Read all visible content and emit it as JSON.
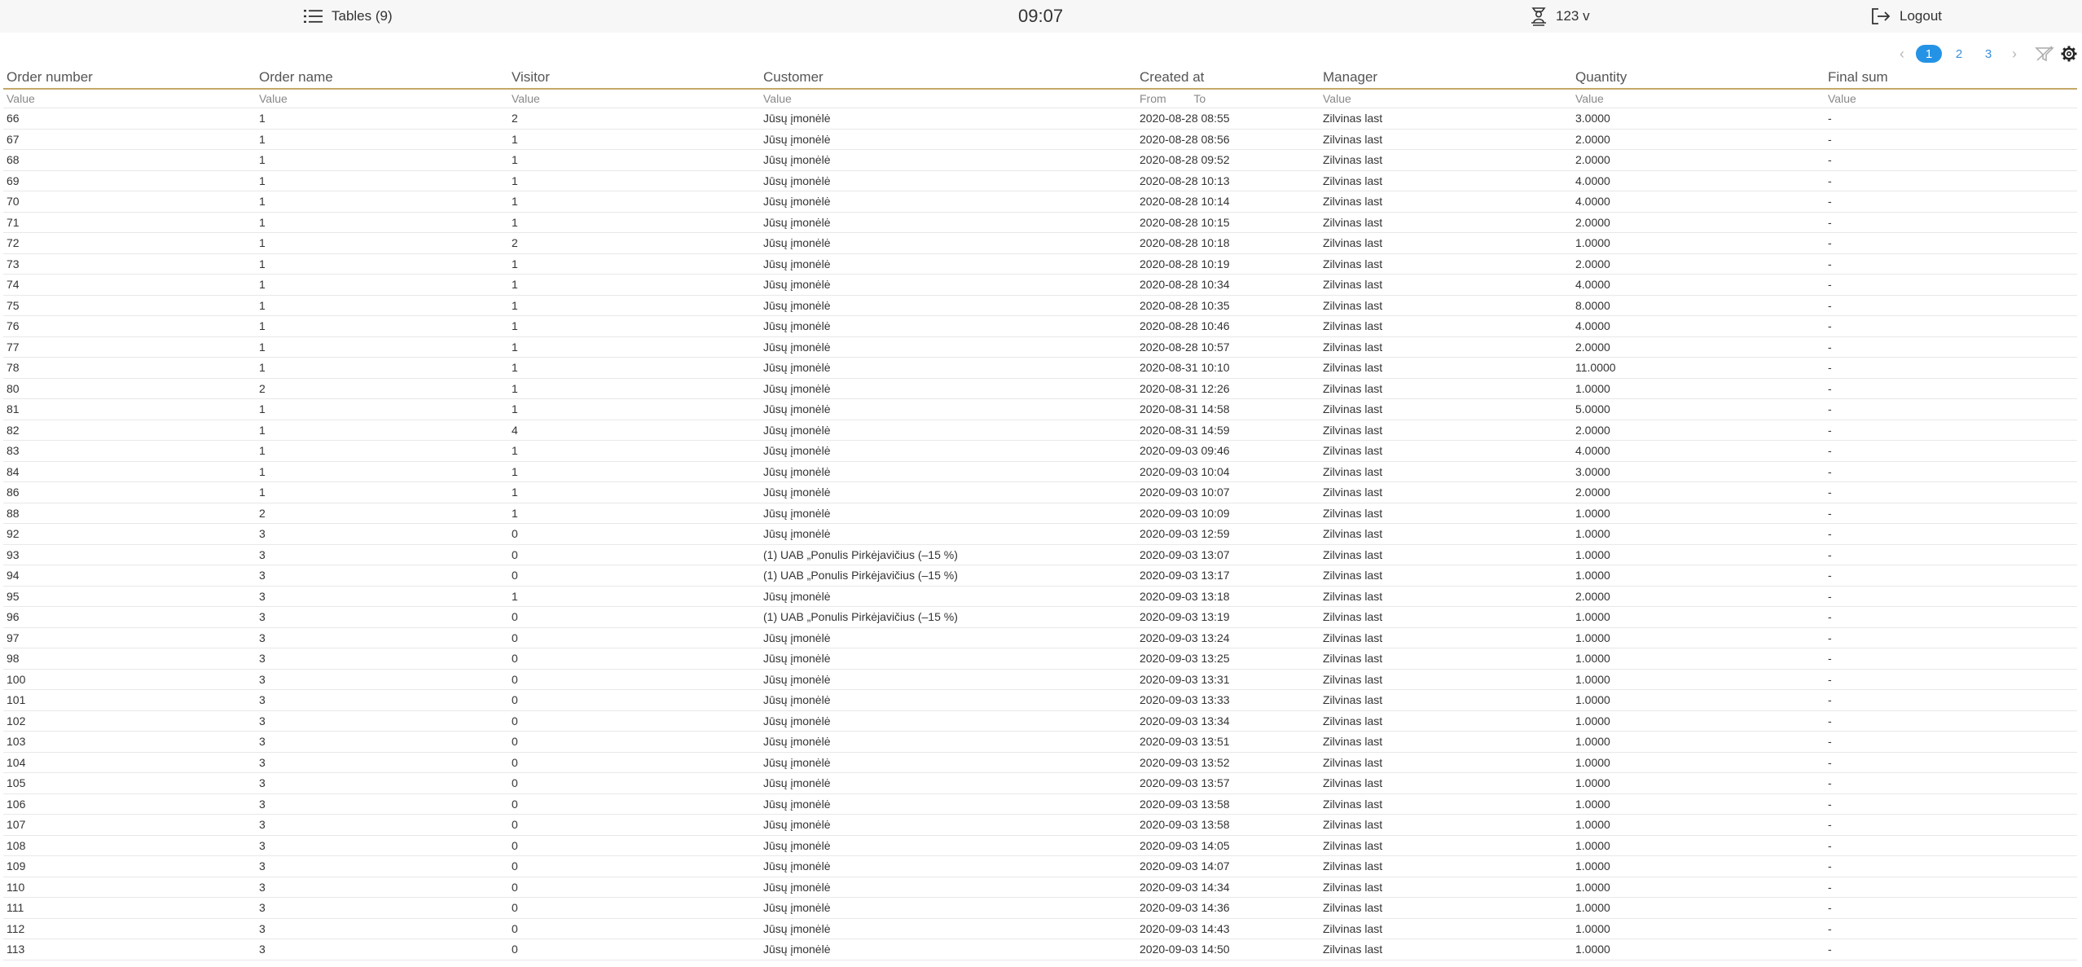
{
  "topbar": {
    "tables_label": "Tables (9)",
    "clock": "09:07",
    "user_label": "123 v",
    "logout_label": "Logout"
  },
  "pager": {
    "prev": "‹",
    "pages": [
      "1",
      "2",
      "3"
    ],
    "active": "1",
    "next": "›"
  },
  "columns": [
    "Order number",
    "Order name",
    "Visitor",
    "Customer",
    "Created at",
    "Manager",
    "Quantity",
    "Final sum"
  ],
  "filters": {
    "value_placeholder": "Value",
    "from_label": "From",
    "to_label": "To"
  },
  "rows": [
    [
      "66",
      "1",
      "2",
      "Jūsų įmonėlė",
      "2020-08-28 08:55",
      "Zilvinas last",
      "3.0000",
      "-"
    ],
    [
      "67",
      "1",
      "1",
      "Jūsų įmonėlė",
      "2020-08-28 08:56",
      "Zilvinas last",
      "2.0000",
      "-"
    ],
    [
      "68",
      "1",
      "1",
      "Jūsų įmonėlė",
      "2020-08-28 09:52",
      "Zilvinas last",
      "2.0000",
      "-"
    ],
    [
      "69",
      "1",
      "1",
      "Jūsų įmonėlė",
      "2020-08-28 10:13",
      "Zilvinas last",
      "4.0000",
      "-"
    ],
    [
      "70",
      "1",
      "1",
      "Jūsų įmonėlė",
      "2020-08-28 10:14",
      "Zilvinas last",
      "4.0000",
      "-"
    ],
    [
      "71",
      "1",
      "1",
      "Jūsų įmonėlė",
      "2020-08-28 10:15",
      "Zilvinas last",
      "2.0000",
      "-"
    ],
    [
      "72",
      "1",
      "2",
      "Jūsų įmonėlė",
      "2020-08-28 10:18",
      "Zilvinas last",
      "1.0000",
      "-"
    ],
    [
      "73",
      "1",
      "1",
      "Jūsų įmonėlė",
      "2020-08-28 10:19",
      "Zilvinas last",
      "2.0000",
      "-"
    ],
    [
      "74",
      "1",
      "1",
      "Jūsų įmonėlė",
      "2020-08-28 10:34",
      "Zilvinas last",
      "4.0000",
      "-"
    ],
    [
      "75",
      "1",
      "1",
      "Jūsų įmonėlė",
      "2020-08-28 10:35",
      "Zilvinas last",
      "8.0000",
      "-"
    ],
    [
      "76",
      "1",
      "1",
      "Jūsų įmonėlė",
      "2020-08-28 10:46",
      "Zilvinas last",
      "4.0000",
      "-"
    ],
    [
      "77",
      "1",
      "1",
      "Jūsų įmonėlė",
      "2020-08-28 10:57",
      "Zilvinas last",
      "2.0000",
      "-"
    ],
    [
      "78",
      "1",
      "1",
      "Jūsų įmonėlė",
      "2020-08-31 10:10",
      "Zilvinas last",
      "11.0000",
      "-"
    ],
    [
      "80",
      "2",
      "1",
      "Jūsų įmonėlė",
      "2020-08-31 12:26",
      "Zilvinas last",
      "1.0000",
      "-"
    ],
    [
      "81",
      "1",
      "1",
      "Jūsų įmonėlė",
      "2020-08-31 14:58",
      "Zilvinas last",
      "5.0000",
      "-"
    ],
    [
      "82",
      "1",
      "4",
      "Jūsų įmonėlė",
      "2020-08-31 14:59",
      "Zilvinas last",
      "2.0000",
      "-"
    ],
    [
      "83",
      "1",
      "1",
      "Jūsų įmonėlė",
      "2020-09-03 09:46",
      "Zilvinas last",
      "4.0000",
      "-"
    ],
    [
      "84",
      "1",
      "1",
      "Jūsų įmonėlė",
      "2020-09-03 10:04",
      "Zilvinas last",
      "3.0000",
      "-"
    ],
    [
      "86",
      "1",
      "1",
      "Jūsų įmonėlė",
      "2020-09-03 10:07",
      "Zilvinas last",
      "2.0000",
      "-"
    ],
    [
      "88",
      "2",
      "1",
      "Jūsų įmonėlė",
      "2020-09-03 10:09",
      "Zilvinas last",
      "1.0000",
      "-"
    ],
    [
      "92",
      "3",
      "0",
      "Jūsų įmonėlė",
      "2020-09-03 12:59",
      "Zilvinas last",
      "1.0000",
      "-"
    ],
    [
      "93",
      "3",
      "0",
      "(1) UAB „Ponulis Pirkėjavičius (–15 %)",
      "2020-09-03 13:07",
      "Zilvinas last",
      "1.0000",
      "-"
    ],
    [
      "94",
      "3",
      "0",
      "(1) UAB „Ponulis Pirkėjavičius (–15 %)",
      "2020-09-03 13:17",
      "Zilvinas last",
      "1.0000",
      "-"
    ],
    [
      "95",
      "3",
      "1",
      "Jūsų įmonėlė",
      "2020-09-03 13:18",
      "Zilvinas last",
      "2.0000",
      "-"
    ],
    [
      "96",
      "3",
      "0",
      "(1) UAB „Ponulis Pirkėjavičius (–15 %)",
      "2020-09-03 13:19",
      "Zilvinas last",
      "1.0000",
      "-"
    ],
    [
      "97",
      "3",
      "0",
      "Jūsų įmonėlė",
      "2020-09-03 13:24",
      "Zilvinas last",
      "1.0000",
      "-"
    ],
    [
      "98",
      "3",
      "0",
      "Jūsų įmonėlė",
      "2020-09-03 13:25",
      "Zilvinas last",
      "1.0000",
      "-"
    ],
    [
      "100",
      "3",
      "0",
      "Jūsų įmonėlė",
      "2020-09-03 13:31",
      "Zilvinas last",
      "1.0000",
      "-"
    ],
    [
      "101",
      "3",
      "0",
      "Jūsų įmonėlė",
      "2020-09-03 13:33",
      "Zilvinas last",
      "1.0000",
      "-"
    ],
    [
      "102",
      "3",
      "0",
      "Jūsų įmonėlė",
      "2020-09-03 13:34",
      "Zilvinas last",
      "1.0000",
      "-"
    ],
    [
      "103",
      "3",
      "0",
      "Jūsų įmonėlė",
      "2020-09-03 13:51",
      "Zilvinas last",
      "1.0000",
      "-"
    ],
    [
      "104",
      "3",
      "0",
      "Jūsų įmonėlė",
      "2020-09-03 13:52",
      "Zilvinas last",
      "1.0000",
      "-"
    ],
    [
      "105",
      "3",
      "0",
      "Jūsų įmonėlė",
      "2020-09-03 13:57",
      "Zilvinas last",
      "1.0000",
      "-"
    ],
    [
      "106",
      "3",
      "0",
      "Jūsų įmonėlė",
      "2020-09-03 13:58",
      "Zilvinas last",
      "1.0000",
      "-"
    ],
    [
      "107",
      "3",
      "0",
      "Jūsų įmonėlė",
      "2020-09-03 13:58",
      "Zilvinas last",
      "1.0000",
      "-"
    ],
    [
      "108",
      "3",
      "0",
      "Jūsų įmonėlė",
      "2020-09-03 14:05",
      "Zilvinas last",
      "1.0000",
      "-"
    ],
    [
      "109",
      "3",
      "0",
      "Jūsų įmonėlė",
      "2020-09-03 14:07",
      "Zilvinas last",
      "1.0000",
      "-"
    ],
    [
      "110",
      "3",
      "0",
      "Jūsų įmonėlė",
      "2020-09-03 14:34",
      "Zilvinas last",
      "1.0000",
      "-"
    ],
    [
      "111",
      "3",
      "0",
      "Jūsų įmonėlė",
      "2020-09-03 14:36",
      "Zilvinas last",
      "1.0000",
      "-"
    ],
    [
      "112",
      "3",
      "0",
      "Jūsų įmonėlė",
      "2020-09-03 14:43",
      "Zilvinas last",
      "1.0000",
      "-"
    ],
    [
      "113",
      "3",
      "0",
      "Jūsų įmonėlė",
      "2020-09-03 14:50",
      "Zilvinas last",
      "1.0000",
      "-"
    ]
  ]
}
